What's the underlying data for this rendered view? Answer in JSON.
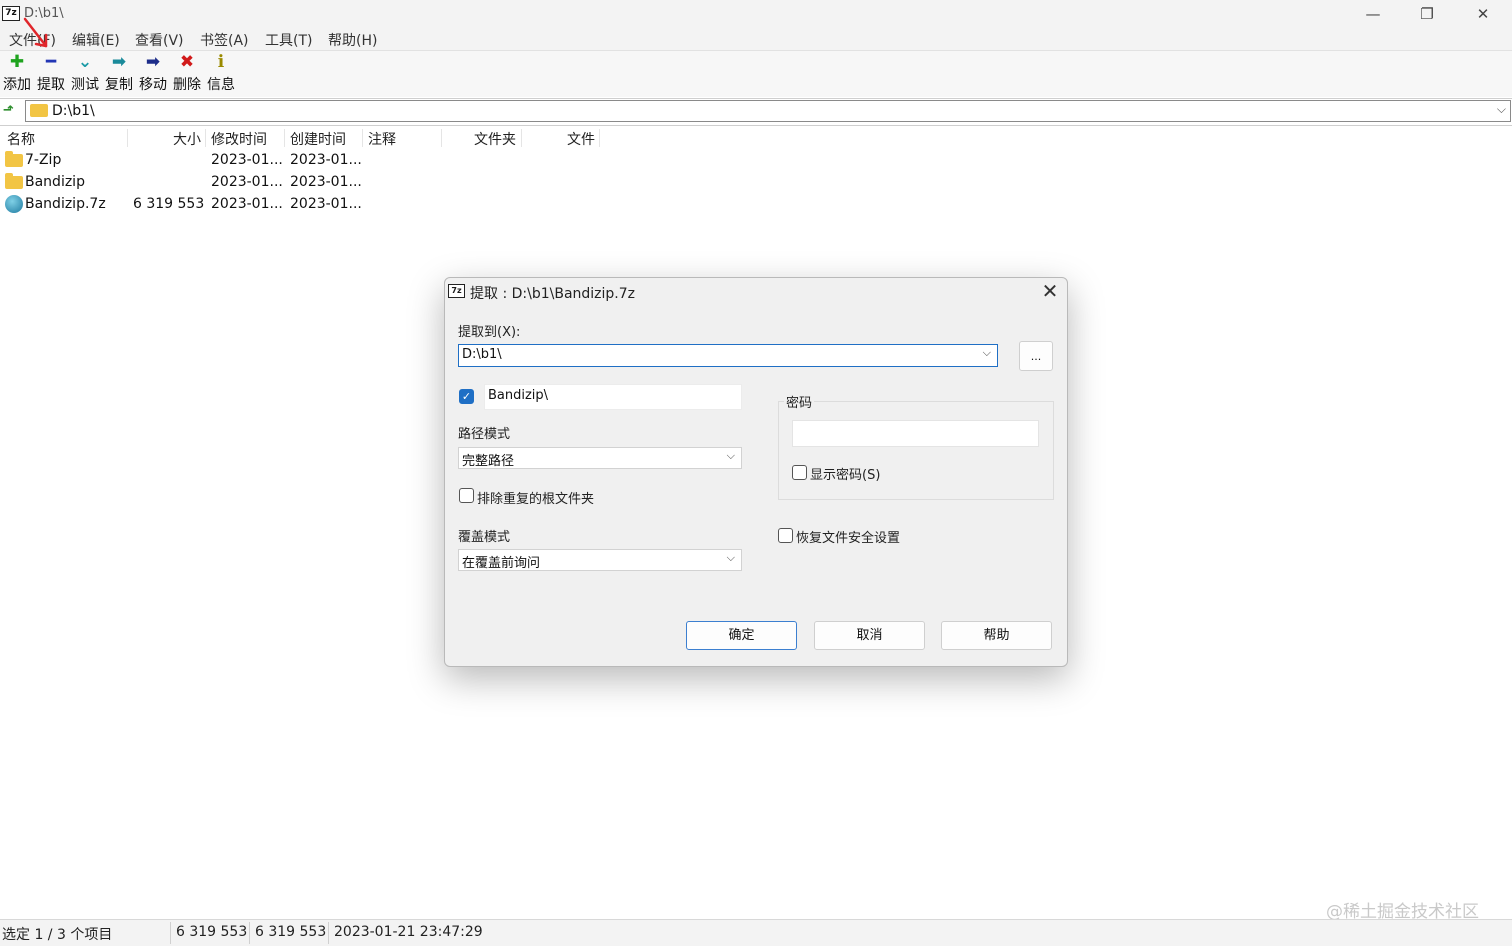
{
  "window": {
    "title": "D:\\b1\\",
    "logo_text": "7z",
    "minimize_glyph": "—",
    "restore_glyph": "❐",
    "close_glyph": "✕"
  },
  "menu": {
    "items": [
      "文件(F)",
      "编辑(E)",
      "查看(V)",
      "书签(A)",
      "工具(T)",
      "帮助(H)"
    ]
  },
  "toolbar": {
    "buttons": [
      {
        "label": "添加",
        "icon": "plus-icon",
        "glyph": "✚",
        "color": "#1fa31f"
      },
      {
        "label": "提取",
        "icon": "minus-icon",
        "glyph": "━",
        "color": "#2336b5"
      },
      {
        "label": "测试",
        "icon": "check-arrow-icon",
        "glyph": "⌄",
        "color": "#1a9aa6"
      },
      {
        "label": "复制",
        "icon": "copy-arrow-icon",
        "glyph": "➡",
        "color": "#1a8a9a"
      },
      {
        "label": "移动",
        "icon": "move-arrow-icon",
        "glyph": "➡",
        "color": "#1d2d8a"
      },
      {
        "label": "删除",
        "icon": "delete-x-icon",
        "glyph": "✖",
        "color": "#d11a1a"
      },
      {
        "label": "信息",
        "icon": "info-icon",
        "glyph": "ℹ",
        "color": "#9a8a00"
      }
    ]
  },
  "address": {
    "path": "D:\\b1\\",
    "up_glyph": "⬏",
    "chevron": "⌵"
  },
  "list": {
    "columns": [
      "名称",
      "大小",
      "修改时间",
      "创建时间",
      "注释",
      "文件夹",
      "文件"
    ],
    "rows": [
      {
        "name": "7-Zip",
        "size": "",
        "modified": "2023-01...",
        "created": "2023-01...",
        "type": "folder"
      },
      {
        "name": "Bandizip",
        "size": "",
        "modified": "2023-01...",
        "created": "2023-01...",
        "type": "folder"
      },
      {
        "name": "Bandizip.7z",
        "size": "6 319 553",
        "modified": "2023-01...",
        "created": "2023-01...",
        "type": "archive"
      }
    ]
  },
  "status": {
    "selection": "选定 1 / 3 个项目",
    "size1": "6 319 553",
    "size2": "6 319 553",
    "datetime": "2023-01-21 23:47:29"
  },
  "watermark": "@稀土掘金技术社区",
  "dialog": {
    "title": "提取 : D:\\b1\\Bandizip.7z",
    "logo_text": "7z",
    "close_glyph": "✕",
    "extract_to_label": "提取到(X):",
    "extract_to_value": "D:\\b1\\",
    "browse_label": "...",
    "subfolder_checked": true,
    "subfolder_value": "Bandizip\\",
    "path_mode_label": "路径模式",
    "path_mode_value": "完整路径",
    "eliminate_root_label": "排除重复的根文件夹",
    "overwrite_label": "覆盖模式",
    "overwrite_value": "在覆盖前询问",
    "password_group_label": "密码",
    "password_value": "",
    "show_password_label": "显示密码(S)",
    "restore_security_label": "恢复文件安全设置",
    "ok_label": "确定",
    "cancel_label": "取消",
    "help_label": "帮助",
    "check_glyph": "✓",
    "chevron": "⌵"
  },
  "colors": {
    "annotation_arrow": "#e0262b",
    "checkbox_accent": "#1f6fc5",
    "folder": "#f2c544"
  }
}
